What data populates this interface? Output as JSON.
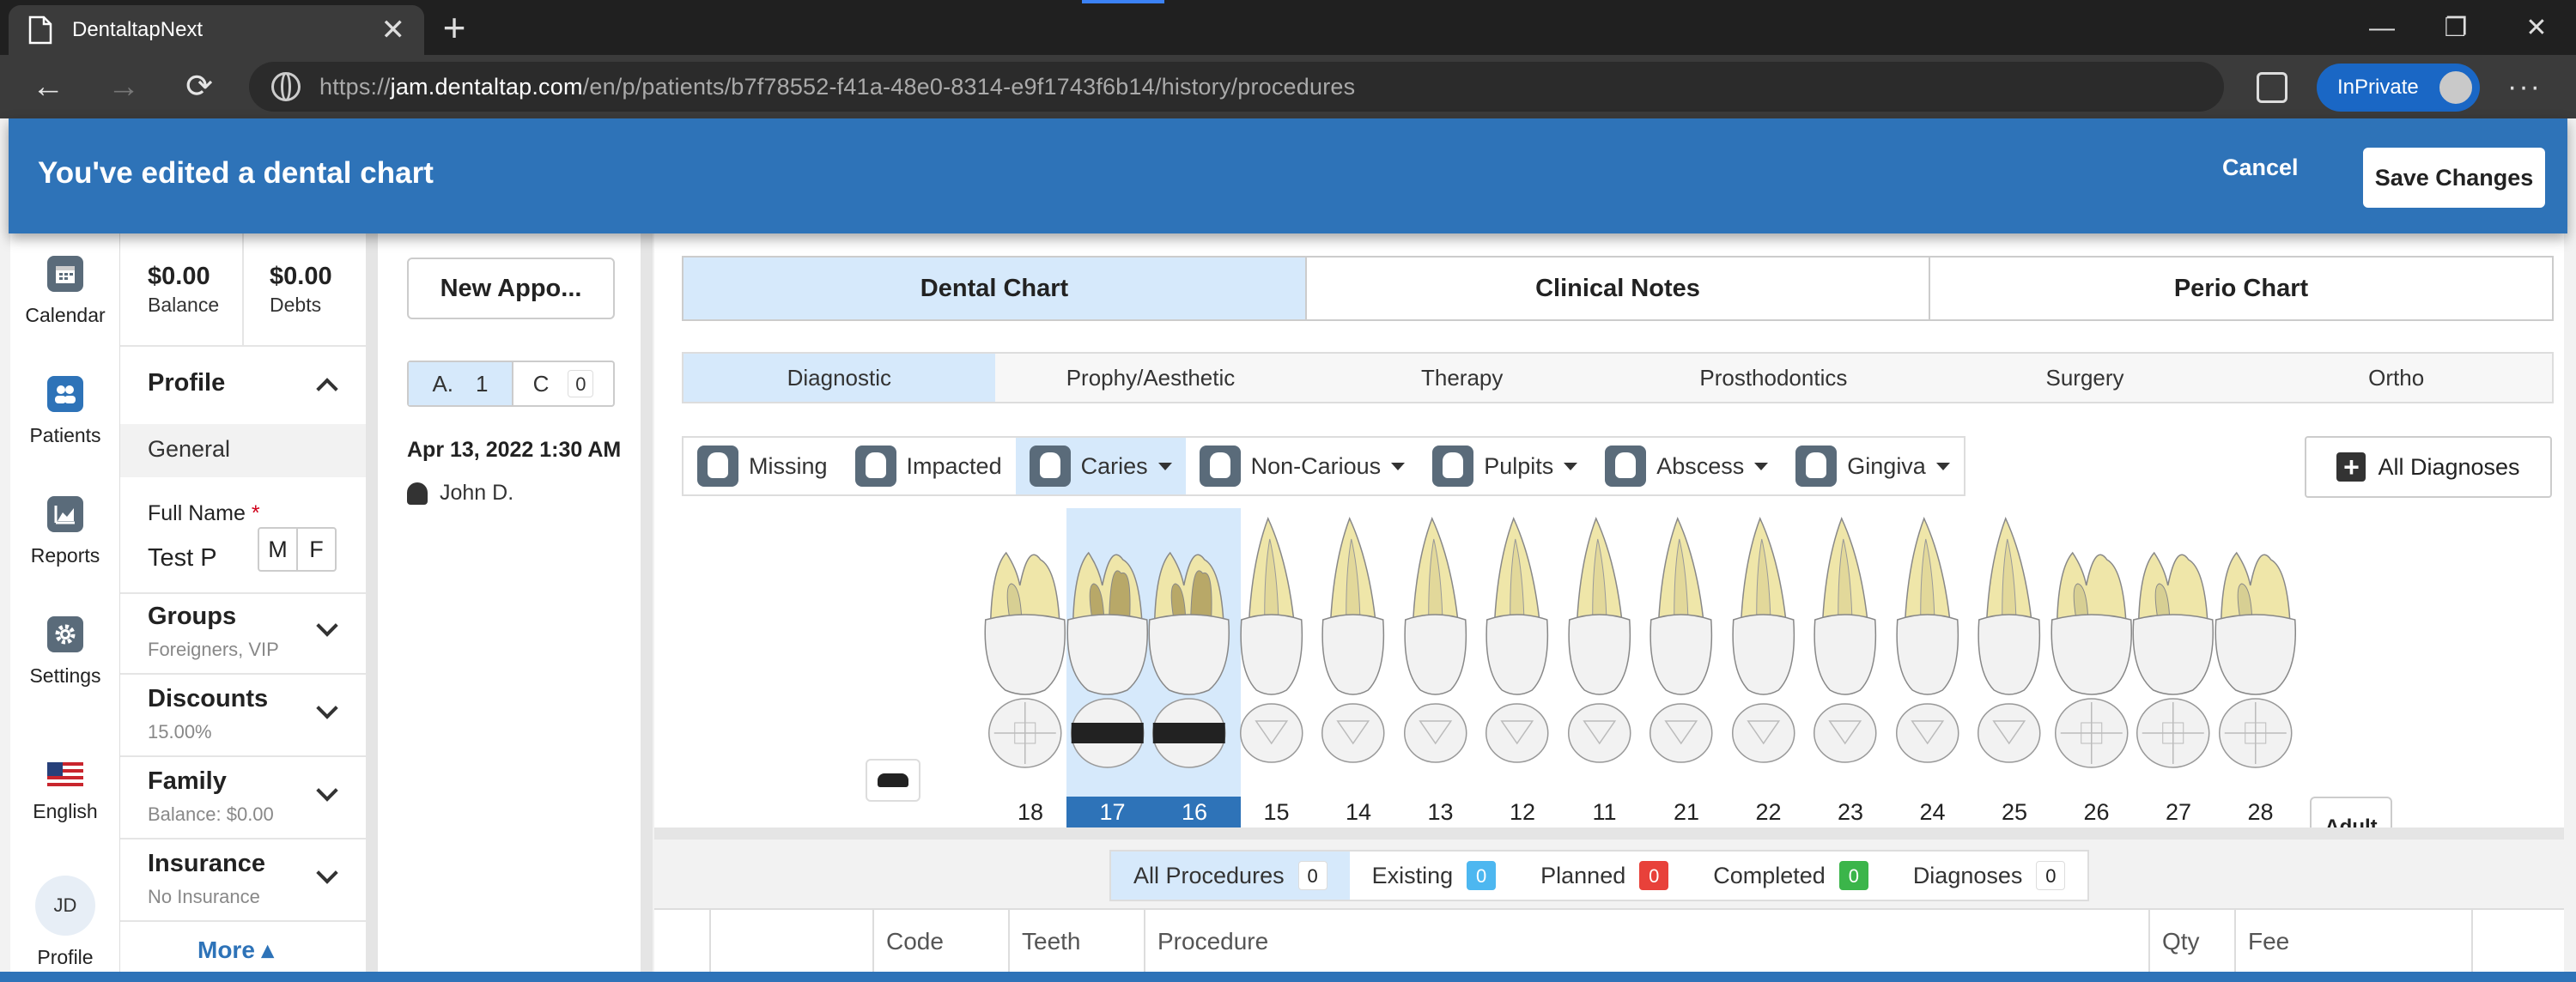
{
  "browser": {
    "tab_title": "DentaltapNext",
    "tab_close": "✕",
    "new_tab": "+",
    "url_prefix": "https://",
    "url_host": "jam.dentaltap.com",
    "url_path": "/en/p/patients/b7f78552-f41a-48e0-8314-e9f1743f6b14/history/procedures",
    "inprivate_label": "InPrivate",
    "back": "←",
    "forward": "→",
    "refresh": "⟳",
    "minimize": "—",
    "restore": "❐",
    "close": "✕",
    "more": "···"
  },
  "banner": {
    "title": "You've edited a dental chart",
    "cancel_label": "Cancel",
    "save_label": "Save Changes",
    "color": "#2e73b8"
  },
  "left_nav": [
    {
      "label": "Calendar",
      "icon": "calendar-icon"
    },
    {
      "label": "Patients",
      "icon": "patients-icon"
    },
    {
      "label": "Reports",
      "icon": "reports-icon"
    },
    {
      "label": "Settings",
      "icon": "gear-icon"
    },
    {
      "label": "English",
      "icon": "us-flag-icon"
    },
    {
      "label": "Profile",
      "initials": "JD"
    }
  ],
  "profile_panel": {
    "balance_value": "$0.00",
    "balance_label": "Balance",
    "debts_value": "$0.00",
    "debts_label": "Debts",
    "profile_title": "Profile",
    "general_label": "General",
    "full_name_label": "Full Name",
    "required_mark": "*",
    "full_name_value": "Test P",
    "gender_m": "M",
    "gender_f": "F",
    "sections": [
      {
        "title": "Groups",
        "sub": "Foreigners, VIP"
      },
      {
        "title": "Discounts",
        "sub": "15.00%"
      },
      {
        "title": "Family",
        "sub": "Balance: $0.00"
      },
      {
        "title": "Insurance",
        "sub": "No Insurance"
      }
    ],
    "more_label": "More ▴"
  },
  "appointments": {
    "new_button": "New Appo...",
    "toggle_a_label": "A.",
    "toggle_a_count": "1",
    "toggle_c_label": "C",
    "toggle_c_count": "0",
    "date": "Apr 13, 2022 1:30 AM",
    "person": "John D."
  },
  "main_tabs": [
    {
      "label": "Dental Chart",
      "active": true
    },
    {
      "label": "Clinical Notes",
      "active": false
    },
    {
      "label": "Perio Chart",
      "active": false
    }
  ],
  "sub_tabs": [
    {
      "label": "Diagnostic",
      "active": true
    },
    {
      "label": "Prophy/Aesthetic",
      "active": false
    },
    {
      "label": "Therapy",
      "active": false
    },
    {
      "label": "Prosthodontics",
      "active": false
    },
    {
      "label": "Surgery",
      "active": false
    },
    {
      "label": "Ortho",
      "active": false
    }
  ],
  "diagnosis_tools": [
    {
      "label": "Missing",
      "dropdown": false,
      "active": false
    },
    {
      "label": "Impacted",
      "dropdown": false,
      "active": false
    },
    {
      "label": "Caries",
      "dropdown": true,
      "active": true
    },
    {
      "label": "Non-Carious",
      "dropdown": true,
      "active": false
    },
    {
      "label": "Pulpits",
      "dropdown": true,
      "active": false
    },
    {
      "label": "Abscess",
      "dropdown": true,
      "active": false
    },
    {
      "label": "Gingiva",
      "dropdown": true,
      "active": false
    }
  ],
  "all_diagnoses_label": "All Diagnoses",
  "teeth": [
    {
      "number": "18",
      "molar": true,
      "selected": false,
      "caries": false
    },
    {
      "number": "17",
      "molar": true,
      "selected": true,
      "caries": true
    },
    {
      "number": "16",
      "molar": true,
      "selected": true,
      "caries": true
    },
    {
      "number": "15",
      "molar": false,
      "selected": false,
      "caries": false
    },
    {
      "number": "14",
      "molar": false,
      "selected": false,
      "caries": false
    },
    {
      "number": "13",
      "molar": false,
      "selected": false,
      "caries": false
    },
    {
      "number": "12",
      "molar": false,
      "selected": false,
      "caries": false
    },
    {
      "number": "11",
      "molar": false,
      "selected": false,
      "caries": false
    },
    {
      "number": "21",
      "molar": false,
      "selected": false,
      "caries": false
    },
    {
      "number": "22",
      "molar": false,
      "selected": false,
      "caries": false
    },
    {
      "number": "23",
      "molar": false,
      "selected": false,
      "caries": false
    },
    {
      "number": "24",
      "molar": false,
      "selected": false,
      "caries": false
    },
    {
      "number": "25",
      "molar": false,
      "selected": false,
      "caries": false
    },
    {
      "number": "26",
      "molar": true,
      "selected": false,
      "caries": false
    },
    {
      "number": "27",
      "molar": true,
      "selected": false,
      "caries": false
    },
    {
      "number": "28",
      "molar": true,
      "selected": false,
      "caries": false
    }
  ],
  "adult_label": "Adult",
  "procedure_filters": [
    {
      "label": "All Procedures",
      "count": "0",
      "badge": "plain",
      "active": true
    },
    {
      "label": "Existing",
      "count": "0",
      "badge": "blue",
      "active": false
    },
    {
      "label": "Planned",
      "count": "0",
      "badge": "red",
      "active": false
    },
    {
      "label": "Completed",
      "count": "0",
      "badge": "green",
      "active": false
    },
    {
      "label": "Diagnoses",
      "count": "0",
      "badge": "plain",
      "active": false
    }
  ],
  "table_columns": [
    "",
    "",
    "Code",
    "Teeth",
    "Procedure",
    "Qty",
    "Fee",
    ""
  ]
}
